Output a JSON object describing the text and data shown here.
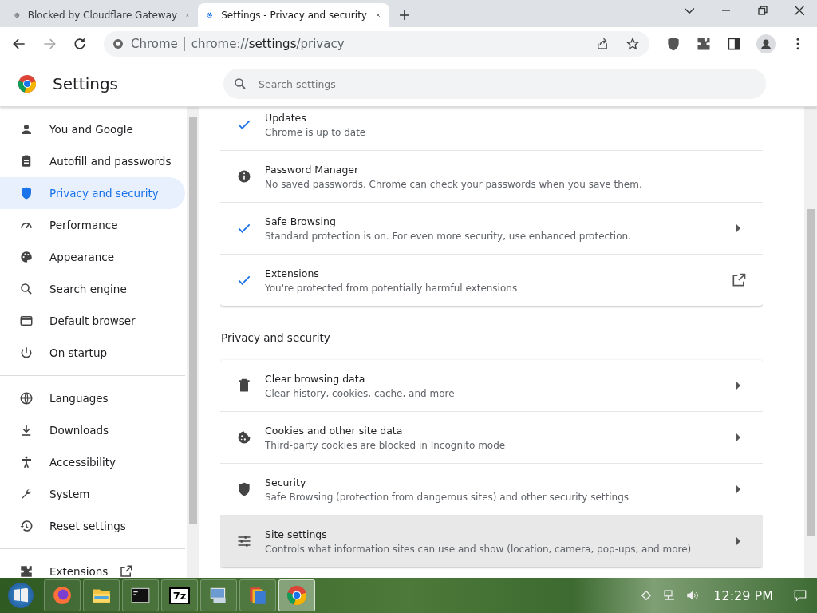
{
  "tabs": [
    {
      "title": "Blocked by Cloudflare Gateway",
      "kind": "globe",
      "selected": false
    },
    {
      "title": "Settings - Privacy and security",
      "kind": "gear",
      "selected": true
    }
  ],
  "toolbar": {
    "site_label": "Chrome",
    "url_prefix": "chrome://",
    "url_host": "settings",
    "url_path": "/privacy"
  },
  "header": {
    "title": "Settings",
    "search": {
      "placeholder": "Search settings"
    }
  },
  "sidebar": {
    "groups": [
      {
        "items": [
          {
            "label": "You and Google",
            "kind": "person",
            "selected": false
          },
          {
            "label": "Autofill and passwords",
            "kind": "clipboard",
            "selected": false
          },
          {
            "label": "Privacy and security",
            "kind": "shield",
            "selected": true
          },
          {
            "label": "Performance",
            "kind": "gauge",
            "selected": false
          },
          {
            "label": "Appearance",
            "kind": "palette",
            "selected": false
          },
          {
            "label": "Search engine",
            "kind": "search",
            "selected": false
          },
          {
            "label": "Default browser",
            "kind": "browser",
            "selected": false
          },
          {
            "label": "On startup",
            "kind": "power",
            "selected": false
          }
        ]
      },
      {
        "items": [
          {
            "label": "Languages",
            "kind": "globe",
            "selected": false
          },
          {
            "label": "Downloads",
            "kind": "download",
            "selected": false
          },
          {
            "label": "Accessibility",
            "kind": "accessibility",
            "selected": false
          },
          {
            "label": "System",
            "kind": "wrench",
            "selected": false
          },
          {
            "label": "Reset settings",
            "kind": "restore",
            "selected": false
          }
        ]
      },
      {
        "items": [
          {
            "label": "Extensions",
            "kind": "puzzle",
            "external": true,
            "selected": false
          }
        ]
      }
    ]
  },
  "sections": [
    {
      "rows": [
        {
          "kind": "check",
          "title": "Updates",
          "subtitle": "Chrome is up to date",
          "has_subpage": false,
          "external": false,
          "hovered": false
        },
        {
          "kind": "info",
          "title": "Password Manager",
          "subtitle": "No saved passwords. Chrome can check your passwords when you save them.",
          "has_subpage": false,
          "external": false,
          "hovered": false
        },
        {
          "kind": "check",
          "title": "Safe Browsing",
          "subtitle": "Standard protection is on. For even more security, use enhanced protection.",
          "has_subpage": true,
          "external": false,
          "hovered": false
        },
        {
          "kind": "check",
          "title": "Extensions",
          "subtitle": "You're protected from potentially harmful extensions",
          "has_subpage": false,
          "external": true,
          "hovered": false
        }
      ]
    },
    {
      "heading": "Privacy and security",
      "rows": [
        {
          "kind": "trash",
          "title": "Clear browsing data",
          "subtitle": "Clear history, cookies, cache, and more",
          "has_subpage": true,
          "external": false,
          "hovered": false
        },
        {
          "kind": "cookie",
          "title": "Cookies and other site data",
          "subtitle": "Third-party cookies are blocked in Incognito mode",
          "has_subpage": true,
          "external": false,
          "hovered": false
        },
        {
          "kind": "shield",
          "title": "Security",
          "subtitle": "Safe Browsing (protection from dangerous sites) and other security settings",
          "has_subpage": true,
          "external": false,
          "hovered": false
        },
        {
          "kind": "tune",
          "title": "Site settings",
          "subtitle": "Controls what information sites can use and show (location, camera, pop-ups, and more)",
          "has_subpage": true,
          "external": false,
          "hovered": true
        }
      ]
    }
  ],
  "taskbar": {
    "apps": [
      {
        "kind": "firefox",
        "selected": false
      },
      {
        "kind": "folder",
        "selected": false
      },
      {
        "kind": "terminal",
        "selected": false
      },
      {
        "kind": "archiver",
        "label": "7z",
        "selected": false
      },
      {
        "kind": "network",
        "selected": false
      },
      {
        "kind": "files",
        "selected": false
      },
      {
        "kind": "chrome",
        "selected": true
      }
    ],
    "clock": "12:29 PM"
  }
}
